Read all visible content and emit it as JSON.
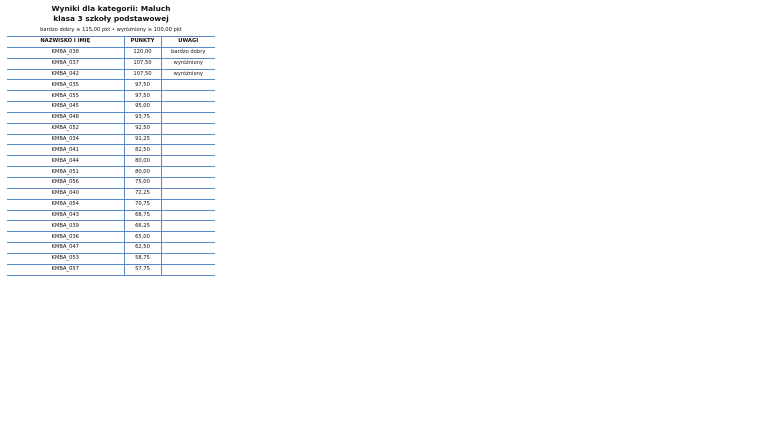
{
  "report": {
    "title_line1": "Wyniki dla kategorii: Maluch",
    "title_line2": "klasa 3 szkoły podstawowej",
    "thresholds": "bardzo dobry ≥ 115,00 pkt  •  wyróżniony ≥ 100,00 pkt"
  },
  "table": {
    "headers": [
      "NAZWISKO I IMIĘ",
      "PUNKTY",
      "UWAGI"
    ],
    "rows": [
      [
        "KMBA_038",
        "120,00",
        "bardzo dobry"
      ],
      [
        "KMBA_037",
        "107,50",
        "wyróżniony"
      ],
      [
        "KMBA_042",
        "107,50",
        "wyróżniony"
      ],
      [
        "KMBA_035",
        "97,50",
        ""
      ],
      [
        "KMBA_055",
        "97,50",
        ""
      ],
      [
        "KMBA_045",
        "95,00",
        ""
      ],
      [
        "KMBA_048",
        "93,75",
        ""
      ],
      [
        "KMBA_052",
        "92,50",
        ""
      ],
      [
        "KMBA_034",
        "91,25",
        ""
      ],
      [
        "KMBA_041",
        "82,50",
        ""
      ],
      [
        "KMBA_044",
        "80,00",
        ""
      ],
      [
        "KMBA_051",
        "80,00",
        ""
      ],
      [
        "KMBA_056",
        "75,00",
        ""
      ],
      [
        "KMBA_040",
        "72,25",
        ""
      ],
      [
        "KMBA_054",
        "70,75",
        ""
      ],
      [
        "KMBA_043",
        "68,75",
        ""
      ],
      [
        "KMBA_039",
        "66,25",
        ""
      ],
      [
        "KMBA_036",
        "65,00",
        ""
      ],
      [
        "KMBA_047",
        "62,50",
        ""
      ],
      [
        "KMBA_053",
        "58,75",
        ""
      ],
      [
        "KMBA_057",
        "57,75",
        ""
      ]
    ]
  },
  "colors": {
    "rule": "#5b8ac9",
    "text": "#111111"
  }
}
